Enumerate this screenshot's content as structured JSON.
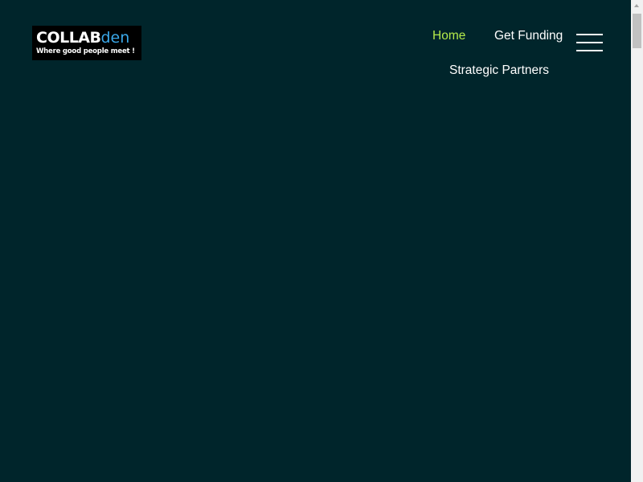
{
  "logo": {
    "main_text": "COLLAB",
    "accent_text": "den",
    "tagline": "Where good people meet !"
  },
  "nav": {
    "home_label": "Home",
    "funding_label": "Get Funding",
    "partners_label": "Strategic Partners",
    "menu_icon": "hamburger-menu-icon"
  },
  "colors": {
    "background": "#00252b",
    "active_link": "#b4ea4a",
    "link": "#ffffff",
    "logo_accent": "#3aa7e8"
  }
}
